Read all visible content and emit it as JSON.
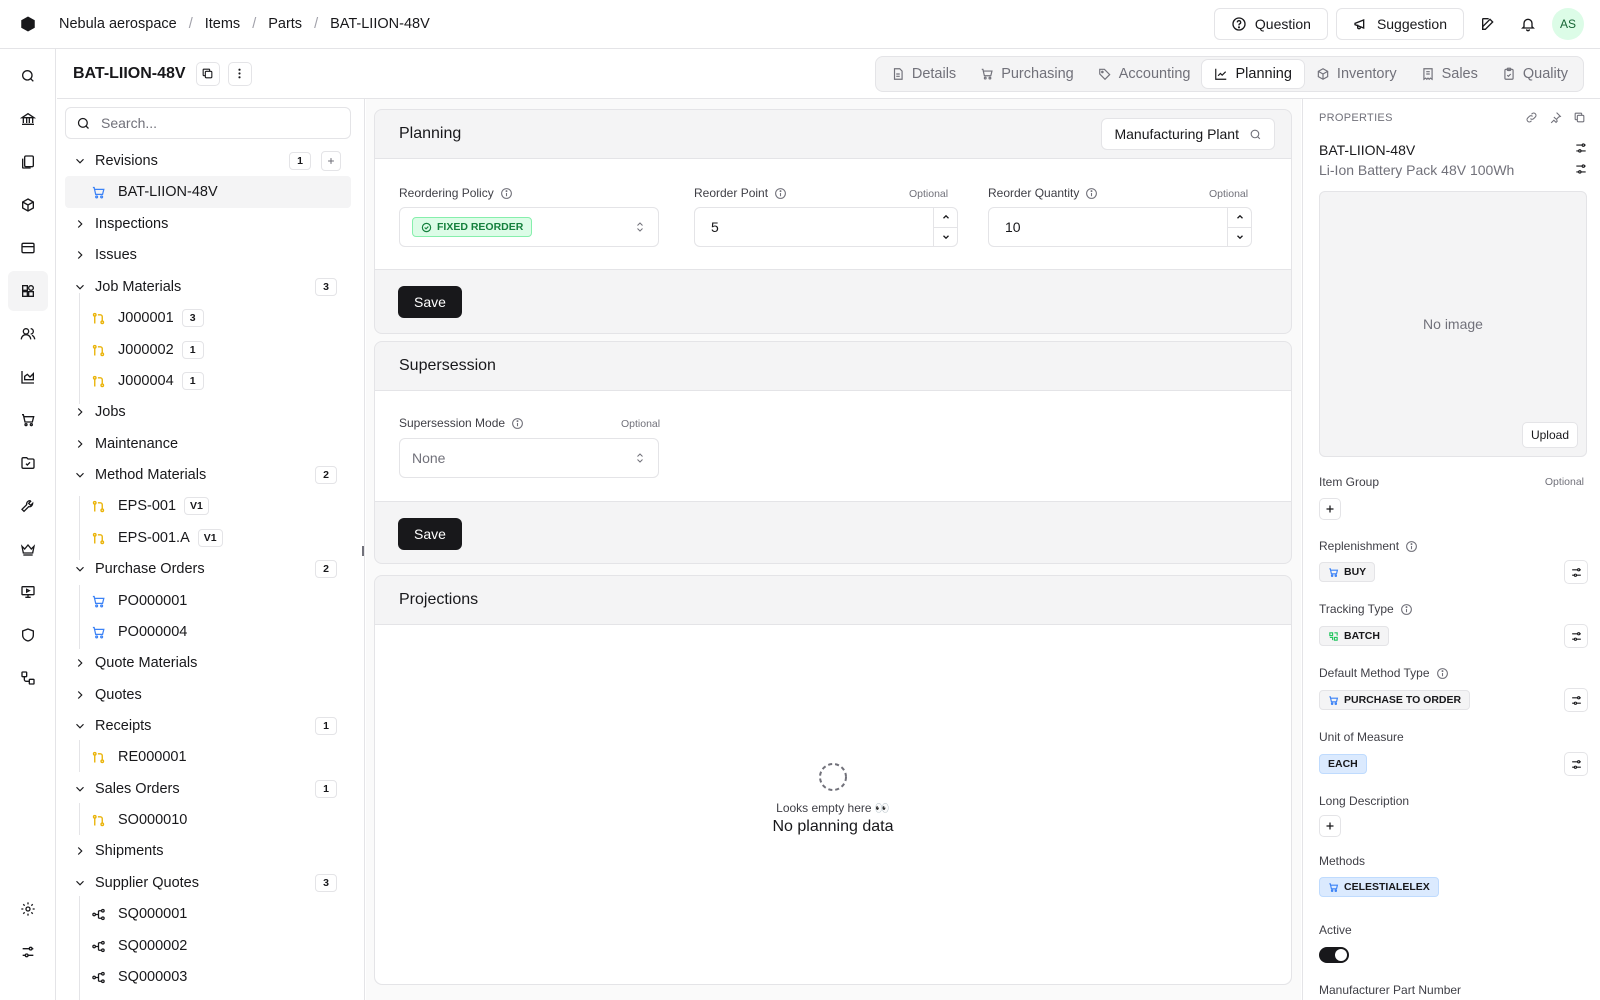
{
  "breadcrumb": {
    "company": "Nebula aerospace",
    "items": "Items",
    "parts": "Parts",
    "current": "BAT-LIION-48V"
  },
  "topbar": {
    "question": "Question",
    "suggestion": "Suggestion",
    "avatar": "AS"
  },
  "header": {
    "title": "BAT-LIION-48V"
  },
  "tabs": [
    {
      "label": "Details",
      "icon": "document-icon"
    },
    {
      "label": "Purchasing",
      "icon": "cart-icon"
    },
    {
      "label": "Accounting",
      "icon": "tag-icon"
    },
    {
      "label": "Planning",
      "icon": "line-chart-icon",
      "active": true
    },
    {
      "label": "Inventory",
      "icon": "box-icon"
    },
    {
      "label": "Sales",
      "icon": "receipt-icon"
    },
    {
      "label": "Quality",
      "icon": "clipboard-icon"
    }
  ],
  "tree": {
    "search_placeholder": "Search...",
    "revisions": {
      "label": "Revisions",
      "count": "1",
      "items": [
        {
          "label": "BAT-LIION-48V"
        }
      ]
    },
    "inspections": "Inspections",
    "issues": "Issues",
    "job_materials": {
      "label": "Job Materials",
      "count": "3",
      "items": [
        {
          "label": "J000001",
          "badge": "3"
        },
        {
          "label": "J000002",
          "badge": "1"
        },
        {
          "label": "J000004",
          "badge": "1"
        }
      ]
    },
    "jobs": "Jobs",
    "maintenance": "Maintenance",
    "method_materials": {
      "label": "Method Materials",
      "count": "2",
      "items": [
        {
          "label": "EPS-001",
          "badge": "V1"
        },
        {
          "label": "EPS-001.A",
          "badge": "V1"
        }
      ]
    },
    "purchase_orders": {
      "label": "Purchase Orders",
      "count": "2",
      "items": [
        {
          "label": "PO000001"
        },
        {
          "label": "PO000004"
        }
      ]
    },
    "quote_materials": "Quote Materials",
    "quotes": "Quotes",
    "receipts": {
      "label": "Receipts",
      "count": "1",
      "items": [
        {
          "label": "RE000001"
        }
      ]
    },
    "sales_orders": {
      "label": "Sales Orders",
      "count": "1",
      "items": [
        {
          "label": "SO000010"
        }
      ]
    },
    "shipments": "Shipments",
    "supplier_quotes": {
      "label": "Supplier Quotes",
      "count": "3",
      "items": [
        {
          "label": "SQ000001"
        },
        {
          "label": "SQ000002"
        },
        {
          "label": "SQ000003"
        }
      ]
    }
  },
  "planning": {
    "title": "Planning",
    "location": "Manufacturing Plant",
    "reordering_policy_label": "Reordering Policy",
    "reordering_policy_value": "FIXED REORDER",
    "reorder_point_label": "Reorder Point",
    "reorder_point_value": "5",
    "reorder_quantity_label": "Reorder Quantity",
    "reorder_quantity_value": "10",
    "optional": "Optional",
    "save": "Save"
  },
  "supersession": {
    "title": "Supersession",
    "mode_label": "Supersession Mode",
    "mode_value": "None",
    "optional": "Optional",
    "save": "Save"
  },
  "projections": {
    "title": "Projections",
    "empty_hint": "Looks empty here 👀",
    "empty_title": "No planning data"
  },
  "properties": {
    "heading": "PROPERTIES",
    "id": "BAT-LIION-48V",
    "description": "Li-Ion Battery Pack 48V 100Wh",
    "no_image": "No image",
    "upload": "Upload",
    "item_group_label": "Item Group",
    "optional": "Optional",
    "replenishment_label": "Replenishment",
    "replenishment_value": "BUY",
    "tracking_label": "Tracking Type",
    "tracking_value": "BATCH",
    "method_type_label": "Default Method Type",
    "method_type_value": "PURCHASE TO ORDER",
    "uom_label": "Unit of Measure",
    "uom_value": "EACH",
    "long_desc_label": "Long Description",
    "methods_label": "Methods",
    "methods_value": "CELESTIALELEX",
    "active_label": "Active",
    "active": true,
    "mpn_label": "Manufacturer Part Number"
  },
  "colors": {
    "accent": "#18181b",
    "green_bg": "#dcfce7",
    "green_text": "#15803d",
    "blue": "#3b82f6",
    "amber": "#eab308",
    "uom_bg": "#dbeafe",
    "methods_bg": "#dbeafe"
  }
}
